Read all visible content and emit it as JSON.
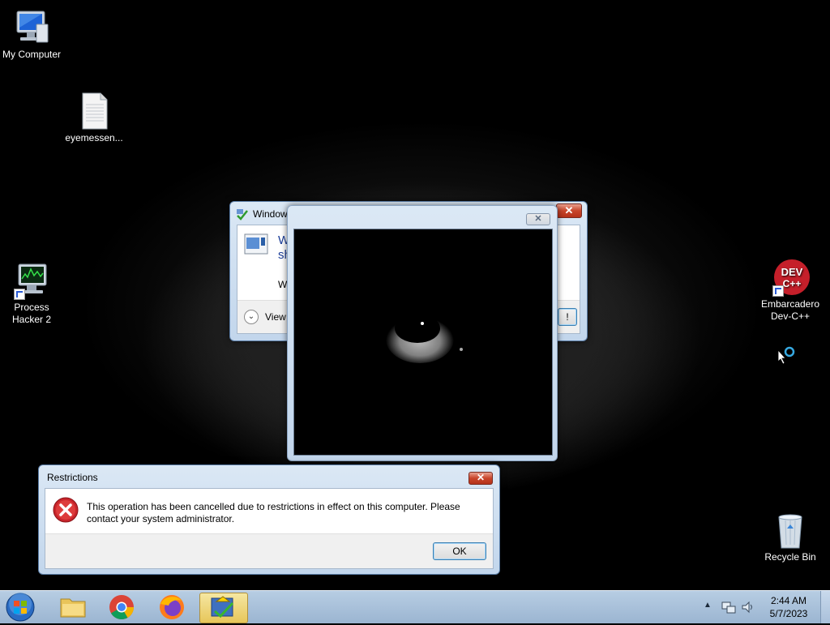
{
  "desktop": {
    "icons": [
      {
        "label": "My Computer"
      },
      {
        "label": "eyemessen..."
      },
      {
        "label": "Process Hacker 2"
      },
      {
        "label": "Embarcadero Dev-C++"
      },
      {
        "label": "Recycle Bin"
      }
    ]
  },
  "background_dialog": {
    "title": "Window",
    "heading_partial": "W sh",
    "body_partial": "W",
    "details_label": "View",
    "button_partial": "!"
  },
  "video_window": {},
  "restrictions_dialog": {
    "title": "Restrictions",
    "message": "This operation has been cancelled due to restrictions in effect on this computer. Please contact your system administrator.",
    "ok_label": "OK"
  },
  "taskbar": {
    "items": [
      "start-orb",
      "windows-explorer",
      "google-chrome",
      "firefox",
      "active-app"
    ],
    "clock_time": "2:44 AM",
    "clock_date": "5/7/2023"
  },
  "colors": {
    "accent_blue": "#2a5bd6",
    "error_red": "#c8252b",
    "close_red": "#c8452b"
  }
}
